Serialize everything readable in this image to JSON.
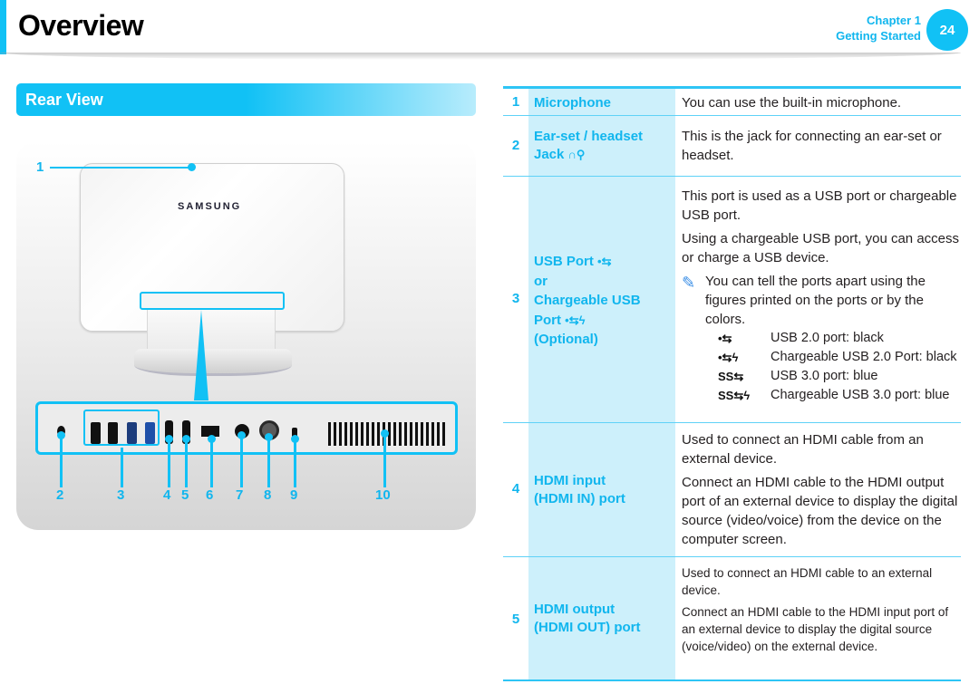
{
  "header": {
    "title": "Overview",
    "chapter": "Chapter 1",
    "chapter_title": "Getting Started",
    "page_number": "24",
    "accent_color": "#11c1f5"
  },
  "section": {
    "title": "Rear View"
  },
  "illustration": {
    "brand": "SAMSUNG",
    "callouts": [
      "1",
      "2",
      "3",
      "4",
      "5",
      "6",
      "7",
      "8",
      "9",
      "10"
    ]
  },
  "table": {
    "rows": [
      {
        "num": "1",
        "name": "Microphone",
        "desc": [
          "You can use the built-in microphone."
        ]
      },
      {
        "num": "2",
        "name_lines": [
          "Ear-set / headset",
          "Jack"
        ],
        "icon": "headset-mic-icon",
        "desc": [
          "This is the jack for connecting an ear-set or headset."
        ]
      },
      {
        "num": "3",
        "name_lines": [
          "USB Port",
          "or",
          "Chargeable USB",
          "Port",
          "(Optional)"
        ],
        "desc": [
          "This port is used as a USB port or chargeable USB port.",
          "Using a chargeable USB port, you can access or charge a USB device."
        ],
        "note": "You can tell the ports apart using the figures printed on the ports or by the colors.",
        "legend": [
          {
            "symbol": "•⇆",
            "icon": "usb-2-icon",
            "text": "USB 2.0 port: black"
          },
          {
            "symbol": "•⇆ϟ",
            "icon": "usb-2-charge-icon",
            "text": "Chargeable USB 2.0 Port: black"
          },
          {
            "symbol": "SS⇆",
            "icon": "usb-3-icon",
            "text": "USB 3.0 port: blue"
          },
          {
            "symbol": "SS⇆ϟ",
            "icon": "usb-3-charge-icon",
            "text": "Chargeable USB 3.0 port: blue"
          }
        ]
      },
      {
        "num": "4",
        "name_lines": [
          "HDMI input",
          "(HDMI IN) port"
        ],
        "desc": [
          "Used to connect an HDMI cable from an external device.",
          "Connect an HDMI cable to the HDMI output port of an external device to display the digital source (video/voice) from the device on the computer screen."
        ]
      },
      {
        "num": "5",
        "name_lines": [
          "HDMI output",
          "(HDMI OUT) port"
        ],
        "desc": [
          "Used to connect an HDMI cable to an external device.",
          "Connect an HDMI cable to the HDMI input port of an external device to display the digital source (voice/video) on the external device."
        ]
      }
    ]
  }
}
